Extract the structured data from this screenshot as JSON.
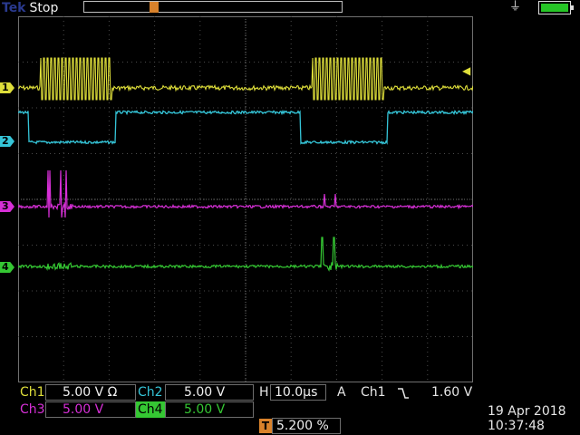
{
  "top": {
    "brand_tek": "Tek",
    "run_state": "Stop",
    "trigger_letter": "T",
    "power_icon": "power-plug-icon",
    "battery_icon": "battery-icon"
  },
  "channels": [
    {
      "id": "1",
      "color": "#dede3a"
    },
    {
      "id": "2",
      "color": "#35c5d8"
    },
    {
      "id": "3",
      "color": "#d62fd6"
    },
    {
      "id": "4",
      "color": "#35c733"
    }
  ],
  "readouts": {
    "ch1_label": "Ch1",
    "ch1_scale": "5.00 V Ω",
    "ch2_label": "Ch2",
    "ch2_scale": "5.00 V",
    "ch3_label": "Ch3",
    "ch3_scale": "5.00 V",
    "ch4_label": "Ch4",
    "ch4_scale": "5.00 V",
    "h_label": "H",
    "h_scale": "10.0µs",
    "trig_mode": "A",
    "trig_source": "Ch1",
    "trig_slope_icon": "falling-edge-icon",
    "trig_level": "1.60 V",
    "trig_pos_letter": "T",
    "trig_pos": "5.200 %",
    "date": "19 Apr 2018",
    "time": "10:37:48"
  }
}
